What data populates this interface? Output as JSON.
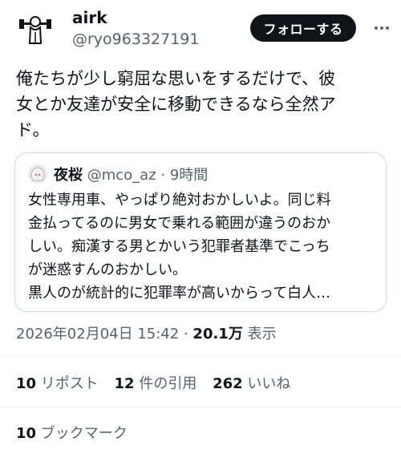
{
  "author": {
    "name": "airk",
    "handle": "@ryo963327191",
    "avatar_icon": "dumbbell-figure-icon"
  },
  "follow_button_label": "フォローする",
  "tweet_text": "俺たちが少し窮屈な思いをするだけで、彼\n女とか友達が安全に移動できるなら全然ア\nド。",
  "quoted": {
    "name": "夜桜",
    "handle": "@mco_az",
    "separator": "·",
    "time": "9時間",
    "avatar_icon": "anime-girl-avatar-icon",
    "text": "女性専用車、やっぱり絶対おかしいよ。同じ料\n金払ってるのに男女で乗れる範囲が違うのおか\nしい。痴漢する男とかいう犯罪者基準でこっち\nが迷惑すんのおかしい。\n黒人のが統計的に犯罪率が高いからって白人…"
  },
  "timestamp": {
    "datetime": "2026年02月04日 15:42",
    "separator": "·",
    "views_count": "20.1万",
    "views_label": "表示"
  },
  "stats": {
    "reposts_count": "10",
    "reposts_label": "リポスト",
    "quotes_count": "12",
    "quotes_label": "件の引用",
    "likes_count": "262",
    "likes_label": "いいね"
  },
  "bookmarks": {
    "count": "10",
    "label": "ブックマーク"
  },
  "colors": {
    "text": "#0f1419",
    "secondary": "#536471",
    "border": "#cfd9de",
    "button_bg": "#0f1419"
  }
}
